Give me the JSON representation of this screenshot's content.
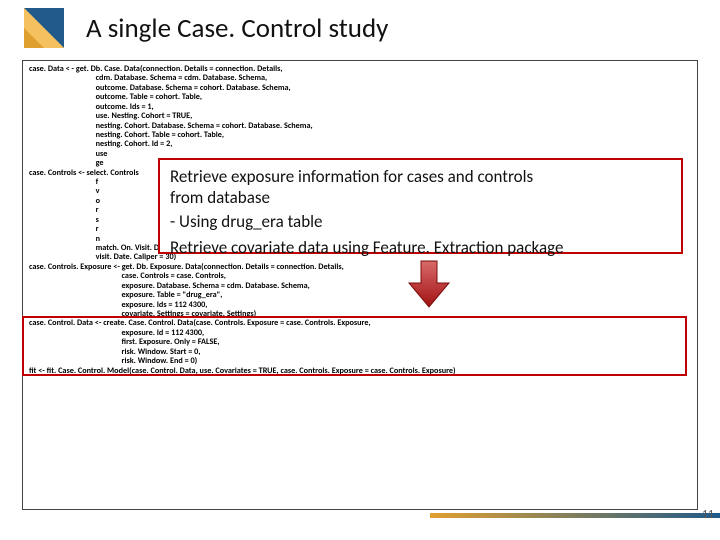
{
  "title": "A single Case. Control study",
  "codelines": [
    "case. Data < - get. Db. Case. Data(connection. Details = connection. Details,",
    "                                    cdm. Database. Schema = cdm. Database. Schema,",
    "                                    outcome. Database. Schema = cohort. Database. Schema,",
    "                                    outcome. Table = cohort. Table,",
    "                                    outcome. Ids = 1,",
    "                                    use. Nesting. Cohort = TRUE,",
    "                                    nesting. Cohort. Database. Schema = cohort. Database. Schema,",
    "                                    nesting. Cohort. Table = cohort. Table,",
    "                                    nesting. Cohort. Id = 2,",
    "                                    use",
    "                                    ge",
    "case. Controls <- select. Controls",
    "                                    f",
    "                                    v",
    "                                    o",
    "                                    r",
    "                                    s",
    "                                    r",
    "                                    n",
    "                                    match. On. Visit. Date = TRUE,",
    "                                    visit. Date. Caliper = 30)",
    "case. Controls. Exposure <- get. Db. Exposure. Data(connection. Details = connection. Details,",
    "                                                  case. Controls = case. Controls,",
    "                                                  exposure. Database. Schema = cdm. Database. Schema,",
    "                                                  exposure. Table = \"drug_era\",",
    "                                                  exposure. Ids = 112 4300,",
    "                                                  covariate. Settings = covariate. Settings)",
    "case. Control. Data <- create. Case. Control. Data(case. Controls. Exposure = case. Controls. Exposure,",
    "                                                  exposure. Id = 112 4300,",
    "                                                  first. Exposure. Only = FALSE,",
    "                                                  risk. Window. Start = 0,",
    "                                                  risk. Window. End = 0)",
    "fit <- fit. Case. Control. Model(case. Control. Data, use. Covariates = TRUE, case. Controls. Exposure = case. Controls. Exposure)"
  ],
  "callout": {
    "line1": "Retrieve exposure information for cases and controls",
    "line2": "from database",
    "bullet1": "-   Using drug_era table",
    "line3": "Retrieve covariate data using Feature. Extraction package"
  },
  "slidenum": "11"
}
